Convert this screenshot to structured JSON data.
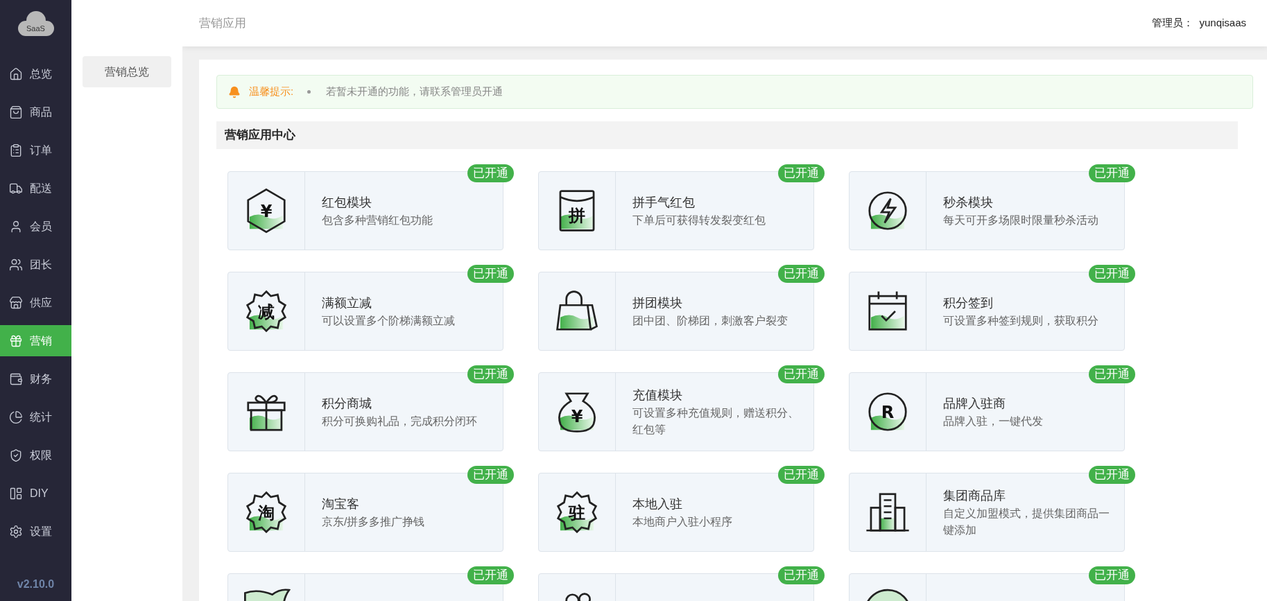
{
  "logo": {
    "text": "SaaS"
  },
  "sidebar": {
    "items": [
      {
        "label": "总览",
        "selected": false
      },
      {
        "label": "商品",
        "selected": false
      },
      {
        "label": "订单",
        "selected": false
      },
      {
        "label": "配送",
        "selected": false
      },
      {
        "label": "会员",
        "selected": false
      },
      {
        "label": "团长",
        "selected": false
      },
      {
        "label": "供应",
        "selected": false
      },
      {
        "label": "营销",
        "selected": true
      },
      {
        "label": "财务",
        "selected": false
      },
      {
        "label": "统计",
        "selected": false
      },
      {
        "label": "权限",
        "selected": false
      },
      {
        "label": "DIY",
        "selected": false
      },
      {
        "label": "设置",
        "selected": false
      }
    ],
    "version": "v2.10.0"
  },
  "submenu": {
    "items": [
      {
        "label": "营销总览",
        "selected": true
      }
    ]
  },
  "header": {
    "title": "营销应用",
    "admin_label": "管理员：",
    "admin_name": "yunqisaas"
  },
  "notice": {
    "title": "温馨提示:",
    "text": "若暂未开通的功能，请联系管理员开通"
  },
  "section": {
    "title": "营销应用中心"
  },
  "cards": [
    {
      "title": "红包模块",
      "desc": "包含多种营销红包功能",
      "glyph": "¥",
      "badge": "已开通"
    },
    {
      "title": "拼手气红包",
      "desc": "下单后可获得转发裂变红包",
      "glyph": "拼",
      "badge": "已开通"
    },
    {
      "title": "秒杀模块",
      "desc": "每天可开多场限时限量秒杀活动",
      "badge": "已开通"
    },
    {
      "title": "满额立减",
      "desc": "可以设置多个阶梯满额立减",
      "glyph": "减",
      "badge": "已开通"
    },
    {
      "title": "拼团模块",
      "desc": "团中团、阶梯团，刺激客户裂变",
      "badge": "已开通"
    },
    {
      "title": "积分签到",
      "desc": "可设置多种签到规则，获取积分",
      "badge": "已开通"
    },
    {
      "title": "积分商城",
      "desc": "积分可换购礼品，完成积分闭环",
      "badge": "已开通"
    },
    {
      "title": "充值模块",
      "desc": "可设置多种充值规则，赠送积分、红包等",
      "glyph": "¥",
      "badge": "已开通"
    },
    {
      "title": "品牌入驻商",
      "desc": "品牌入驻，一键代发",
      "glyph": "R",
      "badge": "已开通"
    },
    {
      "title": "淘宝客",
      "desc": "京东/拼多多推广挣钱",
      "glyph": "淘",
      "badge": "已开通"
    },
    {
      "title": "本地入驻",
      "desc": "本地商户入驻小程序",
      "glyph": "驻",
      "badge": "已开通"
    },
    {
      "title": "集团商品库",
      "desc": "自定义加盟模式，提供集团商品一键添加",
      "badge": "已开通"
    },
    {
      "badge": "已开通"
    },
    {
      "badge": "已开通"
    },
    {
      "badge": "已开通"
    }
  ]
}
